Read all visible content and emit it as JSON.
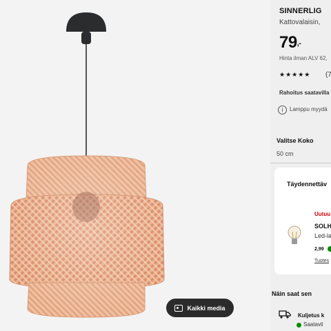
{
  "media": {
    "all_media_label": "Kaikki media",
    "icon": "image-gallery-icon"
  },
  "product": {
    "name": "SINNERLIG",
    "description": "Kattovalaisin, ",
    "price_main": "79",
    "price_suffix": ",-",
    "vat_note": "Hinta ilman ALV 62,",
    "stars": "★★★★★",
    "reviews": "(7",
    "financing": "Rahoitus saatavilla",
    "info_note": "Lamppu myydä",
    "info_icon": "info-icon"
  },
  "size": {
    "label": "Valitse Koko",
    "value": "50 cm"
  },
  "accessories": {
    "title": "Täydennettäv",
    "badge": "Uutuu",
    "product_name": "SOLH",
    "product_desc": "Led-la",
    "product_price": "2,99",
    "product_link": "Tuotes",
    "icon": "bulb-icon"
  },
  "delivery": {
    "title": "Näin saat sen",
    "item": "Kuljetus k",
    "status": "Saatavil",
    "icon": "truck-icon",
    "status_color": "#0a8a00"
  },
  "colors": {
    "accent_red": "#cc0008",
    "available_green": "#0a8a00",
    "button_dark": "#2b2b2b"
  }
}
